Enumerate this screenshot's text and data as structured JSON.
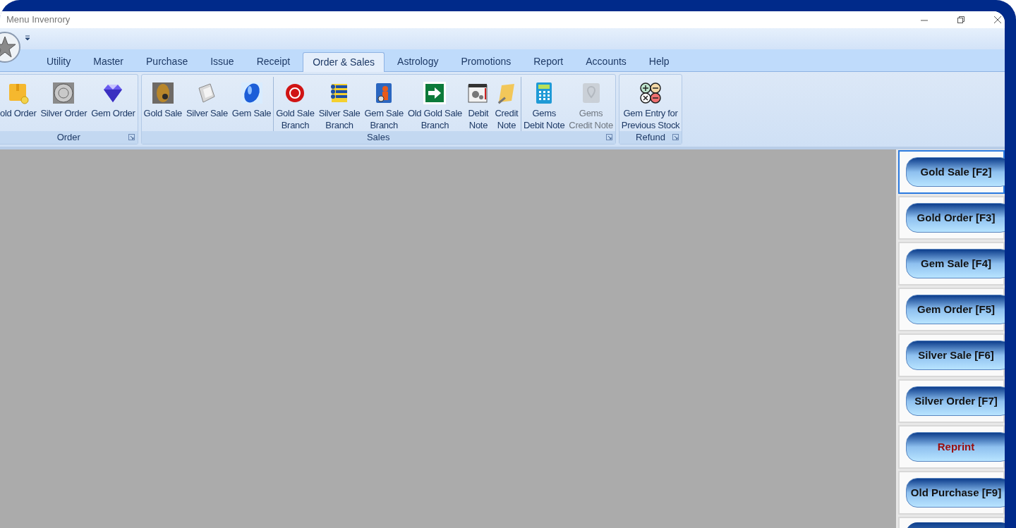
{
  "window": {
    "title": "Menu Invenrory"
  },
  "tabs": [
    {
      "label": "Utility",
      "selected": false
    },
    {
      "label": "Master",
      "selected": false
    },
    {
      "label": "Purchase",
      "selected": false
    },
    {
      "label": "Issue",
      "selected": false
    },
    {
      "label": "Receipt",
      "selected": false
    },
    {
      "label": "Order & Sales",
      "selected": true
    },
    {
      "label": "Astrology",
      "selected": false
    },
    {
      "label": "Promotions",
      "selected": false
    },
    {
      "label": "Report",
      "selected": false
    },
    {
      "label": "Accounts",
      "selected": false
    },
    {
      "label": "Help",
      "selected": false
    }
  ],
  "ribbon_groups": [
    {
      "label": "Order",
      "sections": [
        [
          {
            "label": "old Order",
            "disabled": false
          },
          {
            "label": "Silver Order",
            "disabled": false
          },
          {
            "label": "Gem Order",
            "disabled": false
          }
        ]
      ]
    },
    {
      "label": "Sales",
      "sections": [
        [
          {
            "label": "Gold Sale",
            "disabled": false
          },
          {
            "label": "Silver Sale",
            "disabled": false
          },
          {
            "label": "Gem Sale",
            "disabled": false
          }
        ],
        [
          {
            "label": "Gold Sale\nBranch",
            "disabled": false
          },
          {
            "label": "Silver Sale\nBranch",
            "disabled": false
          },
          {
            "label": "Gem Sale\nBranch",
            "disabled": false
          },
          {
            "label": "Old Gold Sale\nBranch",
            "disabled": false
          },
          {
            "label": "Debit\nNote",
            "disabled": false
          },
          {
            "label": "Credit\nNote",
            "disabled": false
          }
        ],
        [
          {
            "label": "Gems\nDebit Note",
            "disabled": false
          },
          {
            "label": "Gems\nCredit Note",
            "disabled": true
          }
        ]
      ]
    },
    {
      "label": "Refund",
      "sections": [
        [
          {
            "label": "Gem Entry for\nPrevious Stock",
            "disabled": false
          }
        ]
      ]
    }
  ],
  "shortcuts": [
    {
      "label": "Gold Sale [F2]",
      "selected": true,
      "kind": "normal"
    },
    {
      "label": "Gold Order [F3]",
      "selected": false,
      "kind": "normal"
    },
    {
      "label": "Gem Sale [F4]",
      "selected": false,
      "kind": "normal"
    },
    {
      "label": "Gem Order [F5]",
      "selected": false,
      "kind": "normal"
    },
    {
      "label": "Silver Sale [F6]",
      "selected": false,
      "kind": "normal"
    },
    {
      "label": "Silver Order [F7]",
      "selected": false,
      "kind": "normal"
    },
    {
      "label": "Reprint",
      "selected": false,
      "kind": "highlight"
    },
    {
      "label": "Old Purchase [F9]",
      "selected": false,
      "kind": "normal"
    }
  ]
}
